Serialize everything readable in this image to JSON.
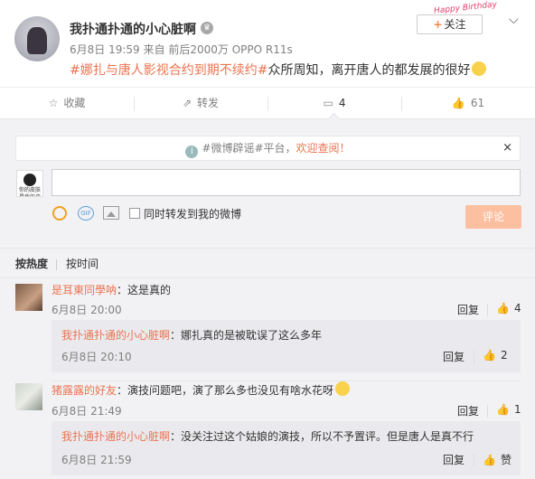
{
  "post": {
    "username": "我扑通扑通的小心脏啊",
    "vip_icon": "crown-icon",
    "date": "6月8日 19:59",
    "source_prefix": "来自",
    "reads": "前后2000万",
    "device": "OPPO R11s",
    "follow_label": "关注",
    "birthday_badge": "Happy Birthday",
    "hashtag": "#娜扎与唐人影视合约到期不续约#",
    "text": "众所周知，离开唐人的都发展的很好"
  },
  "actions": {
    "favorite": "收藏",
    "forward": "转发",
    "comment_count": "4",
    "like_count": "61"
  },
  "notice": {
    "tag": "#微博辟谣#平台，",
    "link": "欢迎查阅！",
    "close": "×"
  },
  "composer": {
    "forward_label": "同时转发到我的微博",
    "submit_label": "评论",
    "my_avatar_text": "你的皮肤是我的皮肤"
  },
  "sort": {
    "hot": "按热度",
    "time": "按时间"
  },
  "comments": [
    {
      "name": "是耳東同學呐",
      "text": "：这是真的",
      "time": "6月8日 20:00",
      "reply_label": "回复",
      "likes": "4",
      "replies": [
        {
          "name": "我扑通扑通的小心脏啊",
          "text": "：娜扎真的是被耽误了这么多年",
          "time": "6月8日 20:10",
          "reply_label": "回复",
          "likes": "2"
        }
      ]
    },
    {
      "name": "猪露露的好友",
      "text": "：演技问题吧，演了那么多也没见有啥水花呀",
      "time": "6月8日 21:49",
      "reply_label": "回复",
      "likes": "1",
      "replies": [
        {
          "name": "我扑通扑通的小心脏啊",
          "text": "：没关注过这个姑娘的演技，所以不予置评。但是唐人是真不行",
          "time": "6月8日 21:59",
          "reply_label": "回复",
          "likes": "赞"
        }
      ]
    }
  ],
  "colors": {
    "accent": "#eb7350",
    "panel_bg": "#f2f2f5",
    "submit_bg": "#fcc0a0"
  }
}
